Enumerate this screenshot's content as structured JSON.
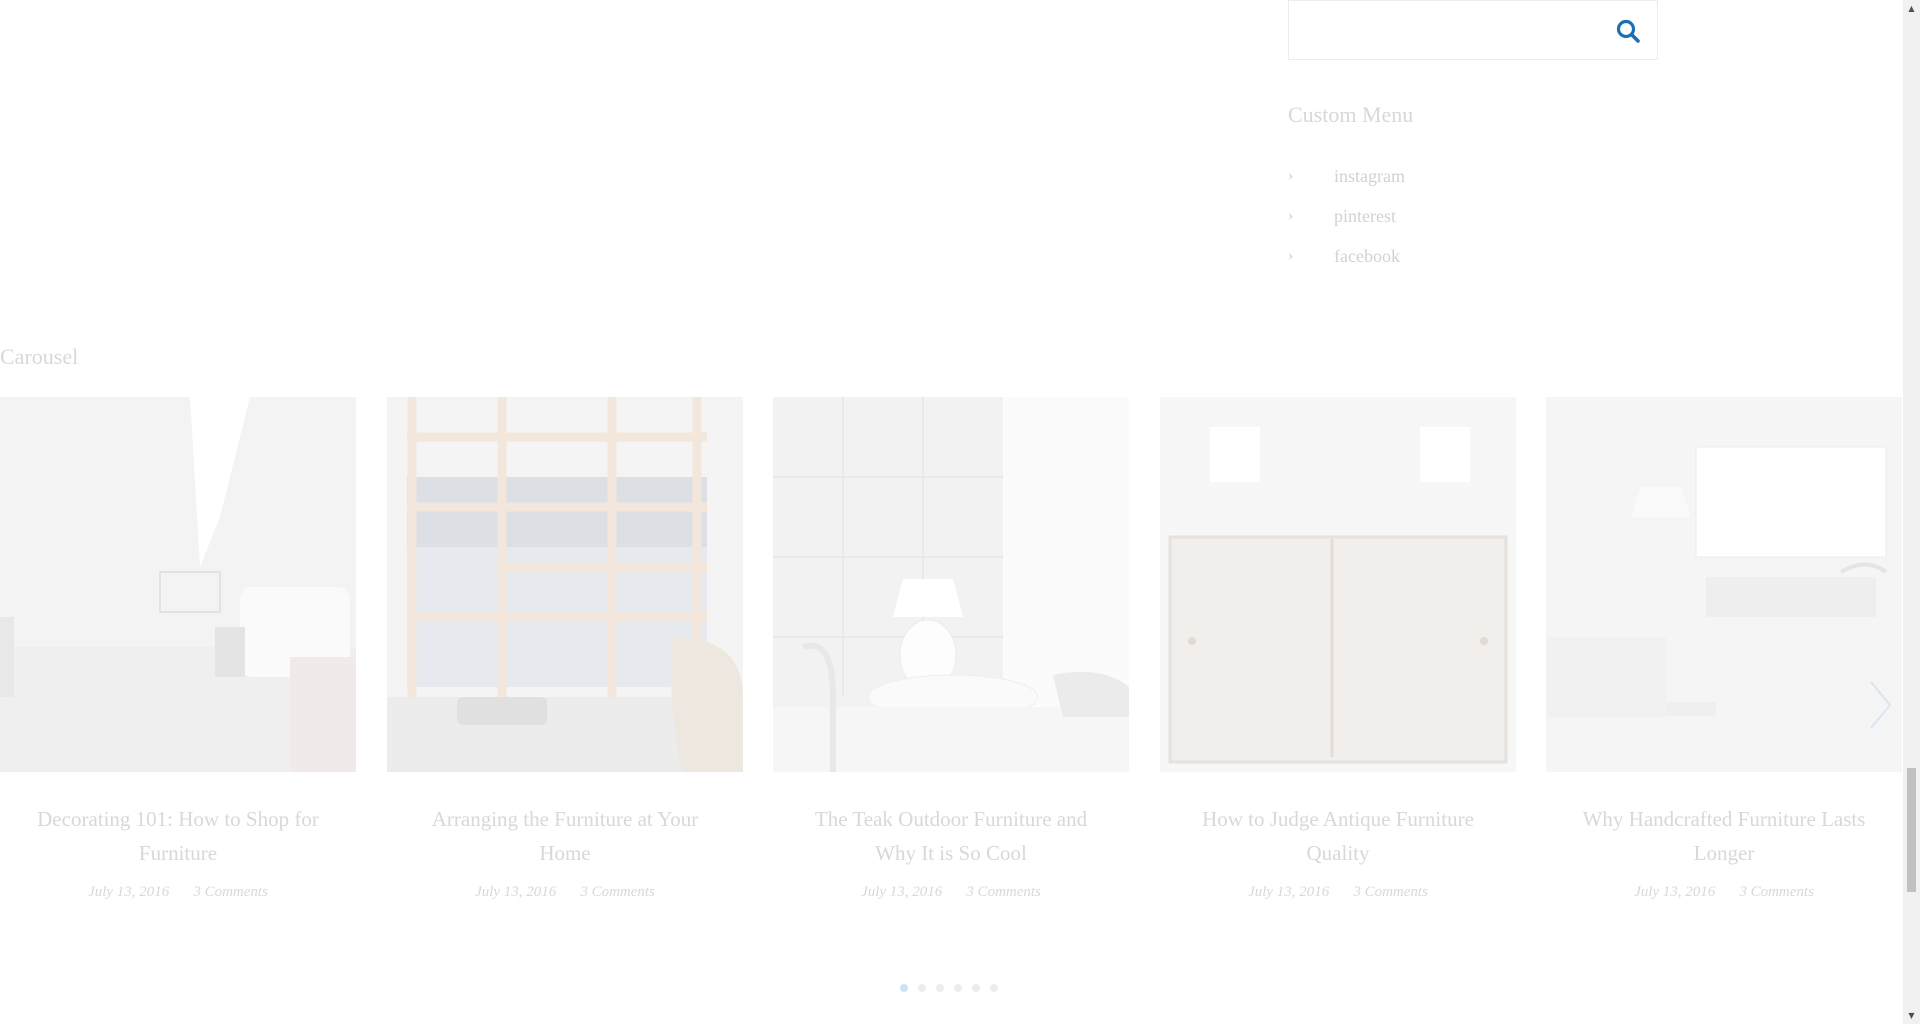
{
  "search": {
    "value": "",
    "placeholder": ""
  },
  "sidebar": {
    "widget_title": "Custom Menu",
    "menu_items": [
      {
        "label": "instagram"
      },
      {
        "label": "pinterest"
      },
      {
        "label": "facebook"
      }
    ]
  },
  "carousel": {
    "title": "Carousel",
    "cards": [
      {
        "title": "Decorating 101: How to Shop for Furniture",
        "date": "July 13, 2016",
        "comments": "3 Comments"
      },
      {
        "title": "Arranging the Furniture at Your Home",
        "date": "July 13, 2016",
        "comments": "3 Comments"
      },
      {
        "title": "The Teak Outdoor Furniture and Why It is So Cool",
        "date": "July 13, 2016",
        "comments": "3 Comments"
      },
      {
        "title": "How to Judge Antique Furniture Quality",
        "date": "July 13, 2016",
        "comments": "3 Comments"
      },
      {
        "title": "Why Handcrafted Furniture Lasts Longer",
        "date": "July 13, 2016",
        "comments": "3 Comments"
      }
    ],
    "dots_count": 6,
    "active_dot": 1
  },
  "colors": {
    "accent": "#1a6fb5",
    "muted_text": "#d8d8d8"
  },
  "icons": {
    "search": "search-icon",
    "menu_bullet": "chevron-right-icon",
    "next": "chevron-right-icon"
  }
}
